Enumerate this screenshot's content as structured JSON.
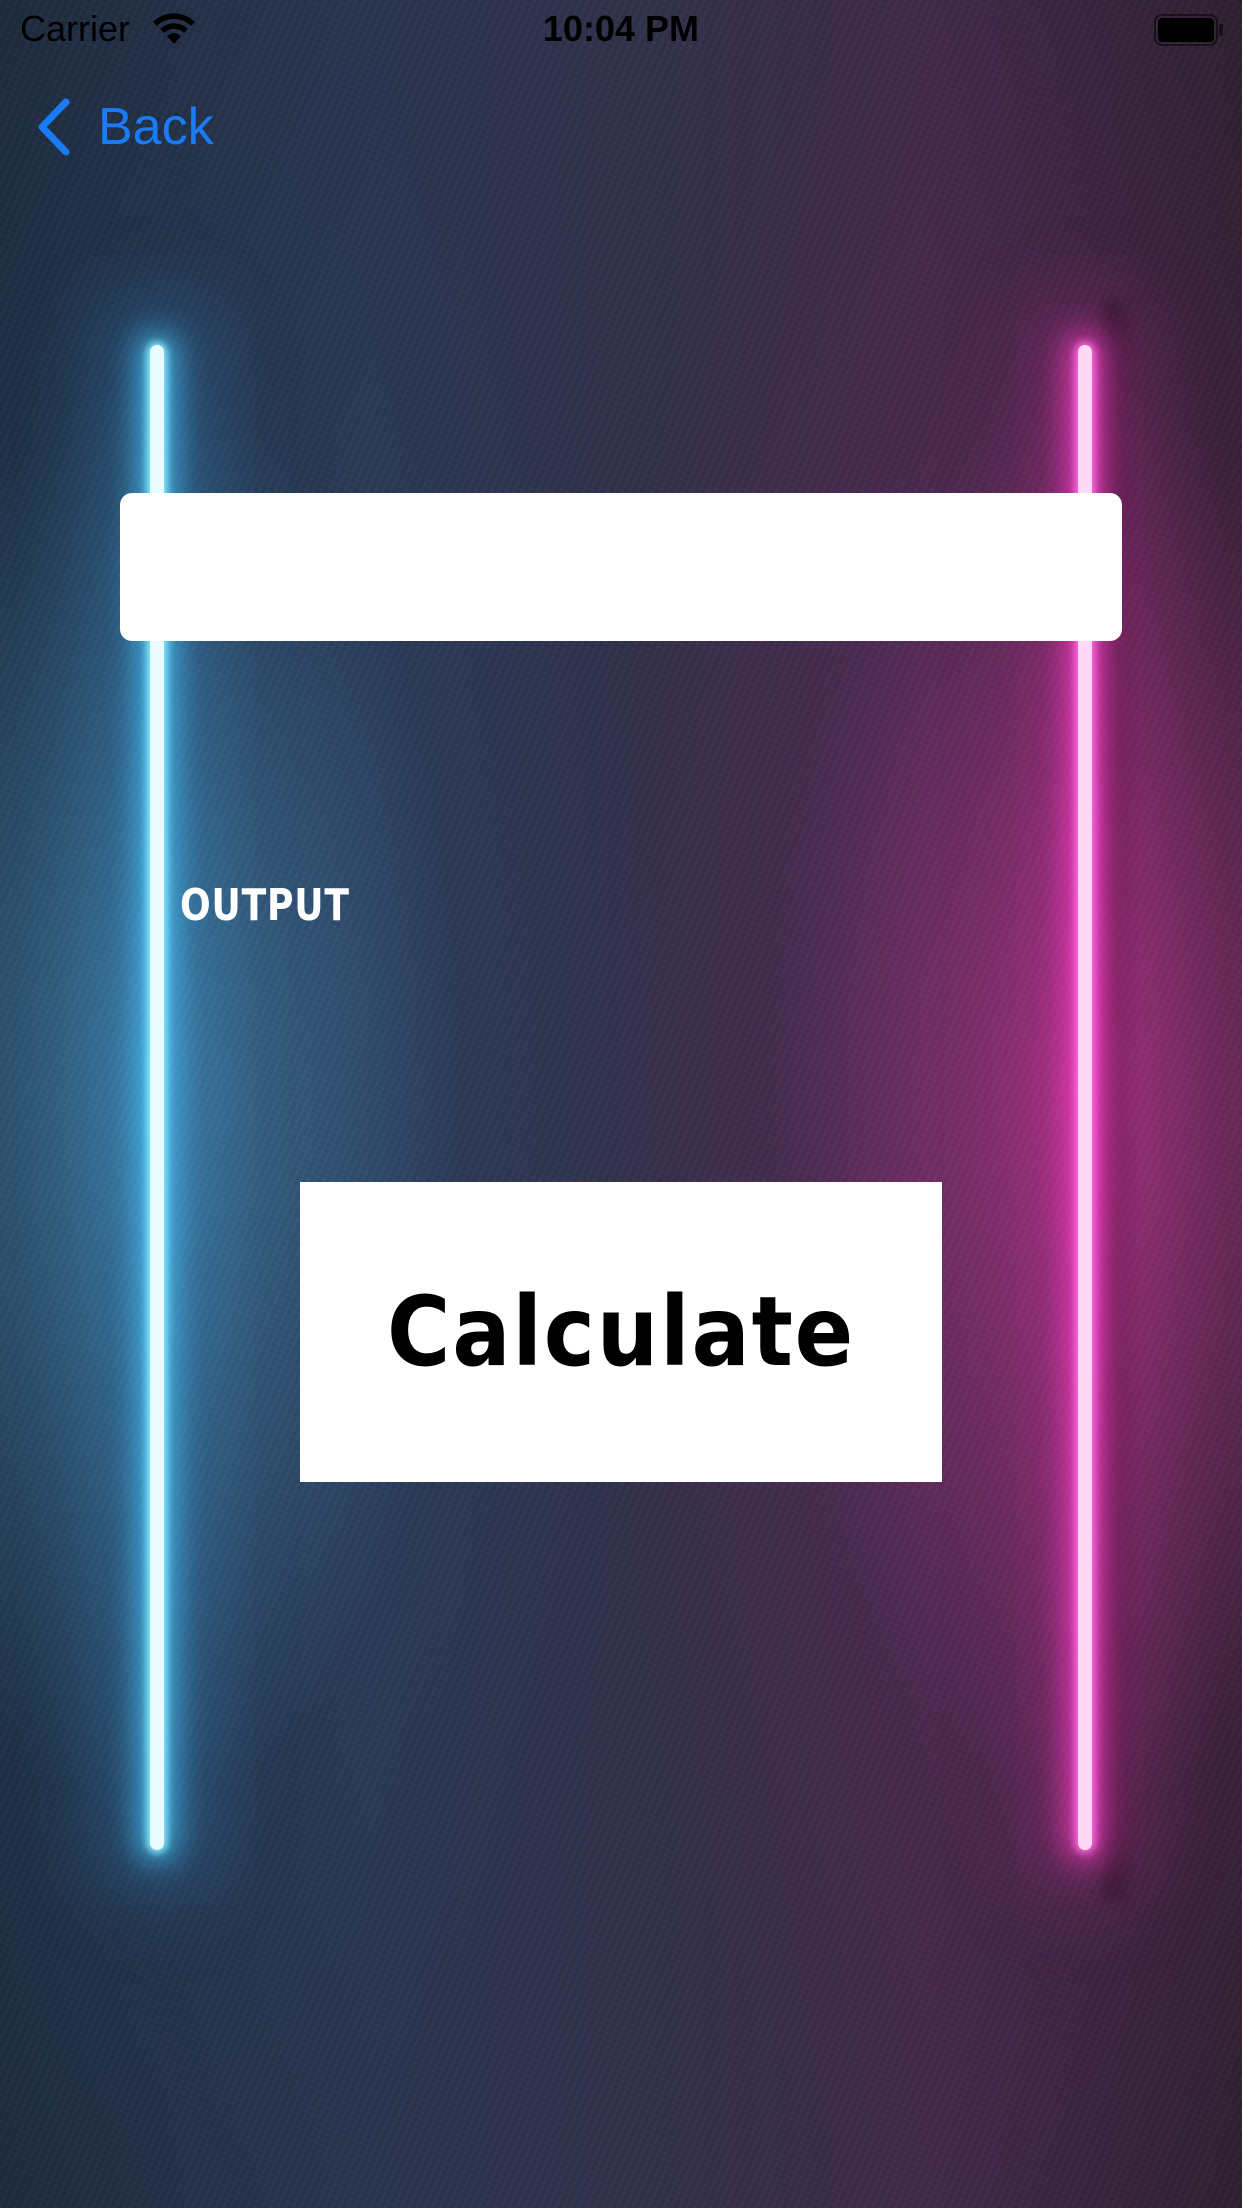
{
  "status_bar": {
    "carrier": "Carrier",
    "time": "10:04 PM",
    "icons": [
      "wifi-icon",
      "battery-icon"
    ]
  },
  "navigation": {
    "back_label": "Back",
    "back_icon": "chevron-left-icon",
    "accent_color": "#1a7cf5"
  },
  "form": {
    "input_value": "",
    "input_placeholder": ""
  },
  "output": {
    "label": "OUTPUT"
  },
  "actions": {
    "calculate_label": "Calculate"
  },
  "theme": {
    "neon_left_color": "#5fd8ff",
    "neon_right_color": "#ff3ccf"
  }
}
